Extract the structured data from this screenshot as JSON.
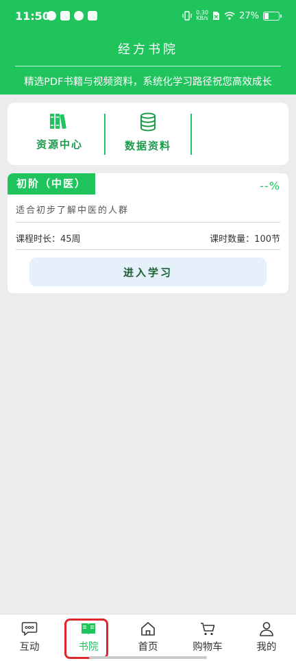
{
  "status_bar": {
    "time": "11:50",
    "net_speed_value": "0.30",
    "net_speed_unit": "KB/s",
    "battery_text": "27%",
    "battery_level": 0.27
  },
  "header": {
    "title": "经方书院",
    "subtitle": "精选PDF书籍与视频资料，系统化学习路径祝您高效成长"
  },
  "resources": {
    "items": [
      {
        "label": "资源中心",
        "icon": "books-icon"
      },
      {
        "label": "数据资料",
        "icon": "database-icon"
      }
    ]
  },
  "course": {
    "level": "初阶（中医）",
    "progress": "--%",
    "description": "适合初步了解中医的人群",
    "duration": "课程时长：45周",
    "lessons": "课时数量：100节",
    "enter_label": "进入学习"
  },
  "bottom_nav": {
    "items": [
      {
        "label": "互动",
        "icon": "chat-bubble-icon"
      },
      {
        "label": "书院",
        "icon": "open-book-icon",
        "active": true
      },
      {
        "label": "首页",
        "icon": "home-icon"
      },
      {
        "label": "购物车",
        "icon": "cart-icon"
      },
      {
        "label": "我的",
        "icon": "person-icon"
      }
    ]
  },
  "colors": {
    "primary_green": "#1fc45d",
    "label_green": "#1d9a4c",
    "highlight_red": "#e0262b",
    "button_bg": "#e6f0fb"
  }
}
